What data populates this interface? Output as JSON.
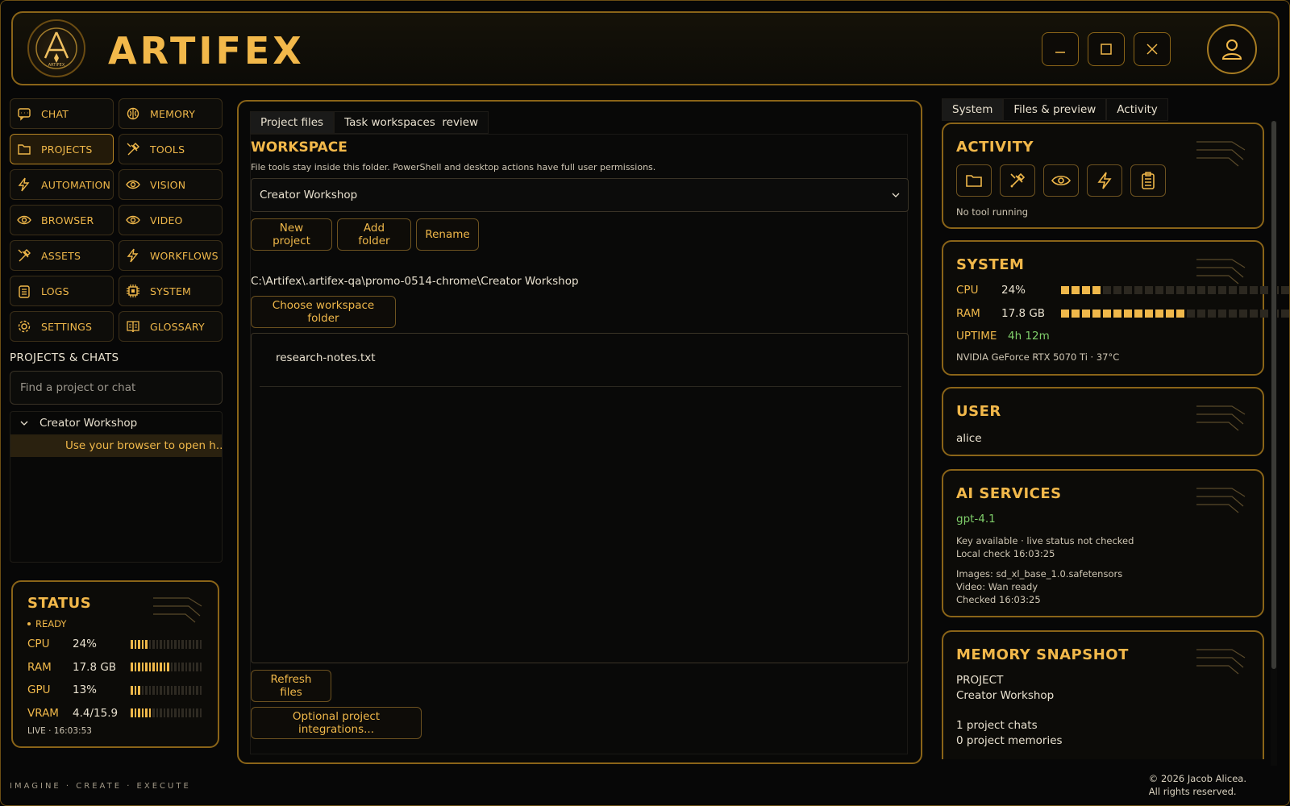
{
  "app": {
    "title": "ARTIFEX",
    "tagline": "IMAGINE · CREATE · EXECUTE",
    "logo_text": "ARTIFEX"
  },
  "colors": {
    "accent": "#f0b84a",
    "border": "#8a6418",
    "background": "#070707",
    "green": "#7fce6a"
  },
  "window": {
    "minimize": "–",
    "maximize": "□",
    "close": "×"
  },
  "nav": {
    "items": [
      {
        "label": "CHAT",
        "icon": "chat-icon",
        "active": false
      },
      {
        "label": "MEMORY",
        "icon": "brain-icon",
        "active": false
      },
      {
        "label": "PROJECTS",
        "icon": "folder-icon",
        "active": true
      },
      {
        "label": "TOOLS",
        "icon": "tools-icon",
        "active": false
      },
      {
        "label": "AUTOMATION",
        "icon": "bolt-icon",
        "active": false
      },
      {
        "label": "VISION",
        "icon": "eye-icon",
        "active": false
      },
      {
        "label": "BROWSER",
        "icon": "eye-icon",
        "active": false
      },
      {
        "label": "VIDEO",
        "icon": "eye-icon",
        "active": false
      },
      {
        "label": "ASSETS",
        "icon": "tools-icon",
        "active": false
      },
      {
        "label": "WORKFLOWS",
        "icon": "bolt-icon",
        "active": false
      },
      {
        "label": "LOGS",
        "icon": "clipboard-icon",
        "active": false
      },
      {
        "label": "SYSTEM",
        "icon": "chip-icon",
        "active": false
      },
      {
        "label": "SETTINGS",
        "icon": "gear-icon",
        "active": false
      },
      {
        "label": "GLOSSARY",
        "icon": "book-icon",
        "active": false
      }
    ]
  },
  "projects": {
    "heading": "PROJECTS & CHATS",
    "search_placeholder": "Find a project or chat",
    "tree_project": "Creator Workshop",
    "tree_chat": "Use your browser to open h..."
  },
  "status": {
    "title": "STATUS",
    "state": "READY",
    "rows": [
      {
        "key": "CPU",
        "value": "24%",
        "fraction": 0.24
      },
      {
        "key": "RAM",
        "value": "17.8 GB",
        "fraction": 0.56
      },
      {
        "key": "GPU",
        "value": "13%",
        "fraction": 0.13
      },
      {
        "key": "VRAM",
        "value": "4.4/15.9",
        "fraction": 0.28
      }
    ],
    "live": "LIVE · 16:03:53"
  },
  "center": {
    "tabs": [
      "Project files",
      "Task workspaces  review"
    ],
    "workspace_title": "WORKSPACE",
    "workspace_sub": "File tools stay inside this folder. PowerShell and desktop actions have full user permissions.",
    "selected_project": "Creator Workshop",
    "buttons": {
      "new_project": "New project",
      "add_folder": "Add folder",
      "rename": "Rename",
      "choose_folder": "Choose workspace folder",
      "refresh": "Refresh files",
      "integrations": "Optional project integrations..."
    },
    "path": "C:\\Artifex\\.artifex-qa\\promo-0514-chrome\\Creator Workshop",
    "files": [
      "research-notes.txt"
    ]
  },
  "right": {
    "tabs": [
      "System",
      "Files & preview",
      "Activity"
    ],
    "activity": {
      "title": "ACTIVITY",
      "status": "No tool running"
    },
    "system": {
      "title": "SYSTEM",
      "cpu_label": "CPU",
      "cpu_value": "24%",
      "cpu_fraction": 0.18,
      "ram_label": "RAM",
      "ram_value": "17.8 GB",
      "ram_fraction": 0.55,
      "uptime_label": "UPTIME",
      "uptime_value": "4h 12m",
      "gpu": "NVIDIA GeForce RTX 5070 Ti · 37°C"
    },
    "user": {
      "title": "USER",
      "name": "alice"
    },
    "ai": {
      "title": "AI SERVICES",
      "model": "gpt-4.1",
      "key_status": "Key available · live status not checked",
      "local_check": "Local check 16:03:25",
      "images": "Images: sd_xl_base_1.0.safetensors",
      "video": "Video: Wan ready",
      "checked": "Checked 16:03:25"
    },
    "memory": {
      "title": "MEMORY SNAPSHOT",
      "project_label": "PROJECT",
      "project_name": "Creator Workshop",
      "chats": "1 project chats",
      "memories": "0 project memories"
    }
  },
  "footer": {
    "line1": "© 2026 Jacob Alicea.",
    "line2": "All rights reserved."
  }
}
